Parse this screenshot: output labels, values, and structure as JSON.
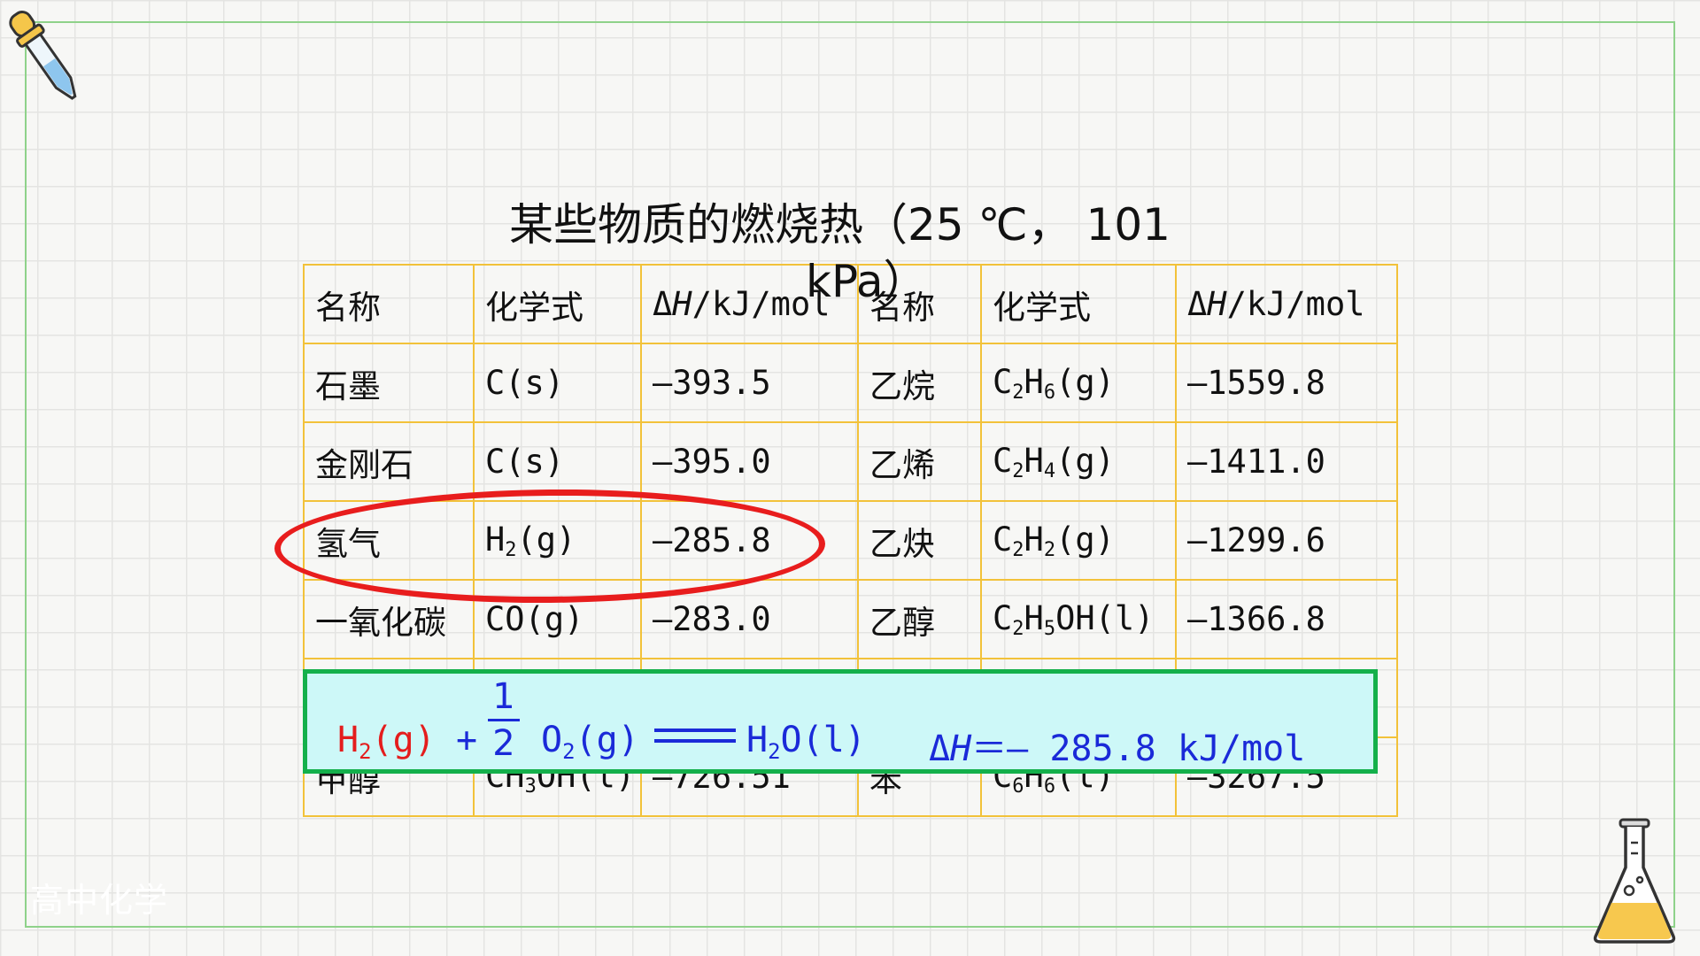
{
  "title": {
    "line1": "某些物质的燃烧热（25 ℃， 101",
    "line2": "kPa）"
  },
  "table": {
    "headers": [
      "名称",
      "化学式",
      "ΔH/kJ/mol",
      "名称",
      "化学式",
      "ΔH/kJ/mol"
    ],
    "rows": [
      [
        "石墨",
        "C(s)",
        "–393.5",
        "乙烷",
        "C2H6(g)",
        "–1559.8"
      ],
      [
        "金刚石",
        "C(s)",
        "–395.0",
        "乙烯",
        "C2H4(g)",
        "–1411.0"
      ],
      [
        "氢气",
        "H2(g)",
        "–285.8",
        "乙炔",
        "C2H2(g)",
        "–1299.6"
      ],
      [
        "一氧化碳",
        "CO(g)",
        "–283.0",
        "乙醇",
        "C2H5OH(l)",
        "–1366.8"
      ],
      [
        "",
        "",
        "",
        "",
        "",
        ""
      ],
      [
        "甲醇",
        "CH3OH(l)",
        "–726.51",
        "苯",
        "C6H6(l)",
        "–3267.5"
      ]
    ]
  },
  "equation": {
    "reactant1": "H2(g)",
    "plus": "+",
    "coef_num": "1",
    "coef_den": "2",
    "reactant2": "O2(g)",
    "product": "H2O(l)",
    "enthalpy": "ΔH＝– 285.8 kJ/mol"
  },
  "watermark": "高中化学",
  "colors": {
    "table_border": "#f2c23a",
    "highlight_ellipse": "#e81d1d",
    "equation_box_bg": "#cdf8f8",
    "equation_box_border": "#14b04b",
    "reactant_red": "#e41d1d",
    "equation_blue": "#1a2ad8",
    "frame_green": "#8fd28a"
  },
  "icons": [
    "dropper-icon",
    "flask-icon"
  ]
}
